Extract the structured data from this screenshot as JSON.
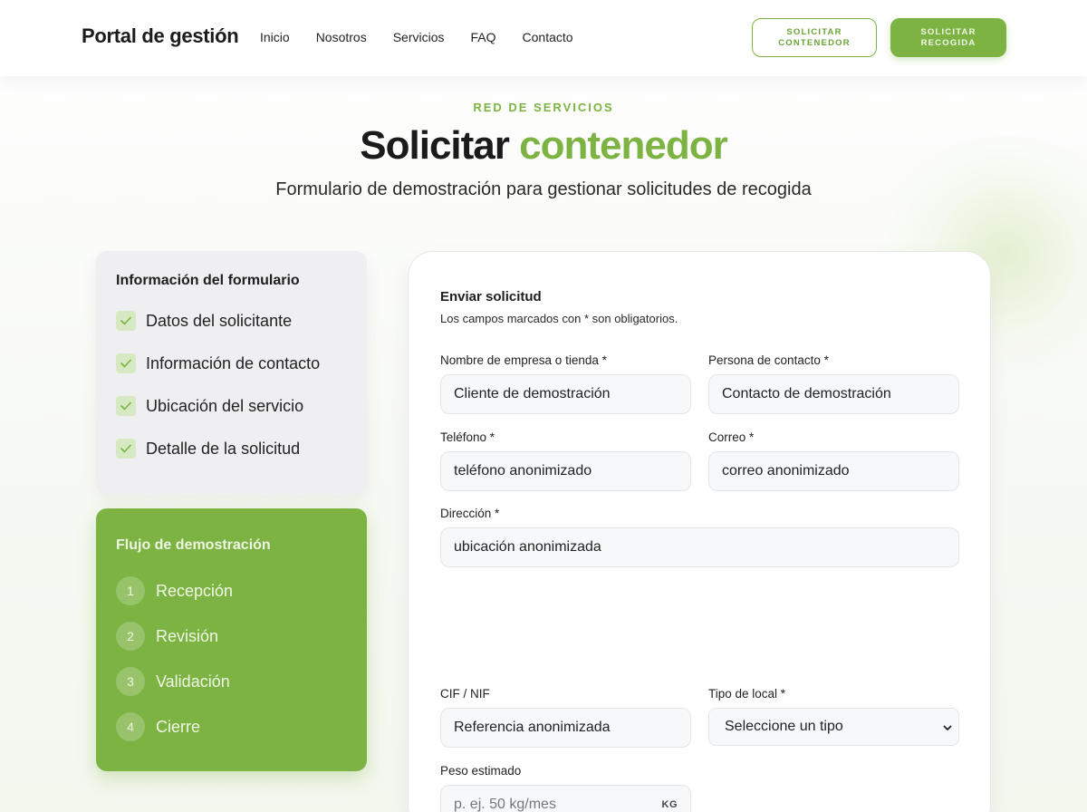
{
  "header": {
    "logo": "Portal de gestión",
    "nav": [
      "Inicio",
      "Nosotros",
      "Servicios",
      "FAQ",
      "Contacto"
    ],
    "btn_container": "SOLICITAR\nCONTENEDOR",
    "btn_pickup": "SOLICITAR\nRECOGIDA"
  },
  "hero": {
    "eyebrow": "RED DE SERVICIOS",
    "title_main": "Solicitar",
    "title_accent": "contenedor",
    "subtitle": "Formulario de demostración para gestionar solicitudes de recogida"
  },
  "info_card": {
    "heading": "Información del formulario",
    "items": [
      "Datos del solicitante",
      "Información de contacto",
      "Ubicación del servicio",
      "Detalle de la solicitud"
    ]
  },
  "flow_card": {
    "heading": "Flujo de demostración",
    "steps": [
      {
        "num": "1",
        "label": "Recepción"
      },
      {
        "num": "2",
        "label": "Revisión"
      },
      {
        "num": "3",
        "label": "Validación"
      },
      {
        "num": "4",
        "label": "Cierre"
      }
    ]
  },
  "form": {
    "title": "Enviar solicitud",
    "note": "Los campos marcados con * son obligatorios.",
    "company": {
      "label": "Nombre de empresa o tienda *",
      "value": "Cliente de demostración"
    },
    "contact": {
      "label": "Persona de contacto *",
      "value": "Contacto de demostración"
    },
    "phone": {
      "label": "Teléfono *",
      "value": "teléfono anonimizado"
    },
    "email": {
      "label": "Correo *",
      "value": "correo anonimizado"
    },
    "address": {
      "label": "Dirección *",
      "value": "ubicación anonimizada"
    },
    "cif": {
      "label": "CIF / NIF",
      "value": "Referencia anonimizada"
    },
    "local_type": {
      "label": "Tipo de local *",
      "value": "Seleccione un tipo"
    },
    "weight": {
      "label": "Peso estimado",
      "placeholder": "p. ej. 50 kg/mes",
      "unit": "KG"
    }
  },
  "colors": {
    "accent": "#7cb342",
    "card_bg": "#efeff1",
    "field_bg": "#f6f8fa"
  },
  "icons": [
    "check-icon",
    "chevron-down-icon"
  ]
}
